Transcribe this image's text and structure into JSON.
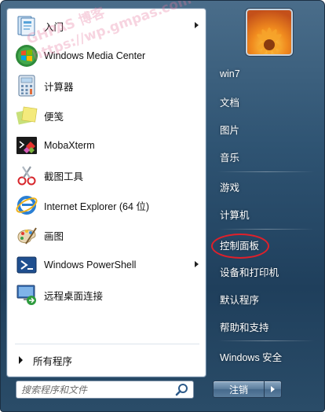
{
  "programs": [
    {
      "label": "入门",
      "icon": "getting-started-icon",
      "has_submenu": true
    },
    {
      "label": "Windows Media Center",
      "icon": "windows-media-center-icon",
      "has_submenu": false
    },
    {
      "label": "计算器",
      "icon": "calculator-icon",
      "has_submenu": false
    },
    {
      "label": "便笺",
      "icon": "sticky-notes-icon",
      "has_submenu": false
    },
    {
      "label": "MobaXterm",
      "icon": "mobaxterm-icon",
      "has_submenu": false
    },
    {
      "label": "截图工具",
      "icon": "snipping-tool-icon",
      "has_submenu": false
    },
    {
      "label": "Internet Explorer (64 位)",
      "icon": "internet-explorer-icon",
      "has_submenu": false
    },
    {
      "label": "画图",
      "icon": "paint-icon",
      "has_submenu": false
    },
    {
      "label": "Windows PowerShell",
      "icon": "powershell-icon",
      "has_submenu": true
    },
    {
      "label": "远程桌面连接",
      "icon": "remote-desktop-icon",
      "has_submenu": false
    }
  ],
  "all_programs_label": "所有程序",
  "search": {
    "placeholder": "搜索程序和文件"
  },
  "right_panel": {
    "items": [
      "win7",
      "文档",
      "图片",
      "音乐",
      "游戏",
      "计算机",
      "控制面板",
      "设备和打印机",
      "默认程序",
      "帮助和支持",
      "Windows 安全"
    ],
    "highlighted_item": "控制面板",
    "highlight_color": "#e0202a"
  },
  "shutdown_label": "注销",
  "watermark": {
    "line1": "GHPAS 博客",
    "line2": "https://wp.gmpas.com"
  },
  "colors": {
    "frame": "#2f5473",
    "panel_bg": "#ffffff",
    "right_text": "#ffffff"
  }
}
